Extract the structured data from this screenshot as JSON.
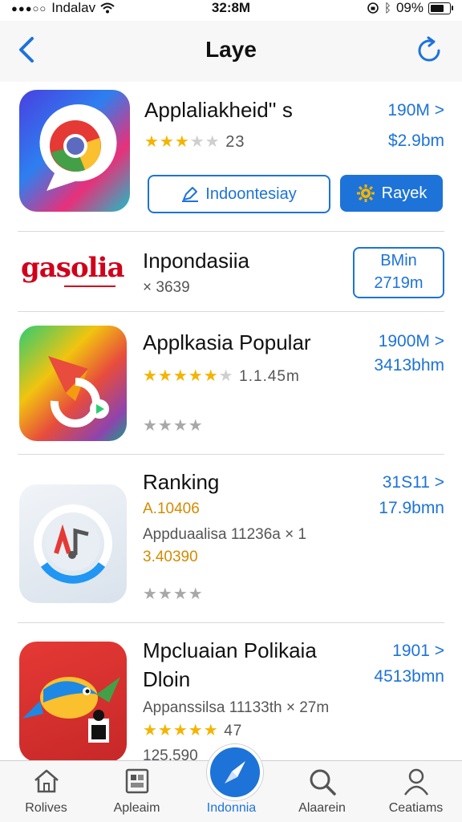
{
  "status_bar": {
    "carrier": "Indalav",
    "time": "32:8M",
    "battery": "09%"
  },
  "nav": {
    "title": "Laye"
  },
  "apps": [
    {
      "name": "Applaliakheid'' s",
      "rating_count": "23",
      "right_top": "190M >",
      "right_bottom": "$2.9bm",
      "btn_outline": "Indoontesiay",
      "btn_solid": "Rayek"
    },
    {
      "logo_text": "gasolia",
      "name": "Inpondasiia",
      "meta": "× 3639",
      "box_line1": "BMin",
      "box_line2": "2719m"
    },
    {
      "name": "Applkasia Popular",
      "meta": "1.1.45m",
      "right_top": "1900M >",
      "right_bottom": "3413bhm"
    },
    {
      "name": "Ranking",
      "sub1": "A.10406",
      "sub2": "Appduaalisa   11236a × 1",
      "sub3": "3.40390",
      "right_top": "31S11 >",
      "right_bottom": "17.9bmn"
    },
    {
      "name_line1": "Mpcluaian Polikaia",
      "name_line2": "Dloin",
      "sub1": "Appanssilsa   11133th × 27m",
      "rating": "47",
      "sub3": "125.590",
      "right_top": "1901 >",
      "right_bottom": "4513bmn"
    }
  ],
  "tabs": [
    {
      "label": "Rolives",
      "icon": "home-icon"
    },
    {
      "label": "Apleaim",
      "icon": "apps-icon"
    },
    {
      "label": "Indonnia",
      "icon": "compass-icon"
    },
    {
      "label": "Alaarein",
      "icon": "search-icon"
    },
    {
      "label": "Ceatiams",
      "icon": "person-icon"
    }
  ],
  "colors": {
    "accent": "#1d73d8",
    "star": "#f4b400",
    "logo_red": "#d0021b"
  }
}
